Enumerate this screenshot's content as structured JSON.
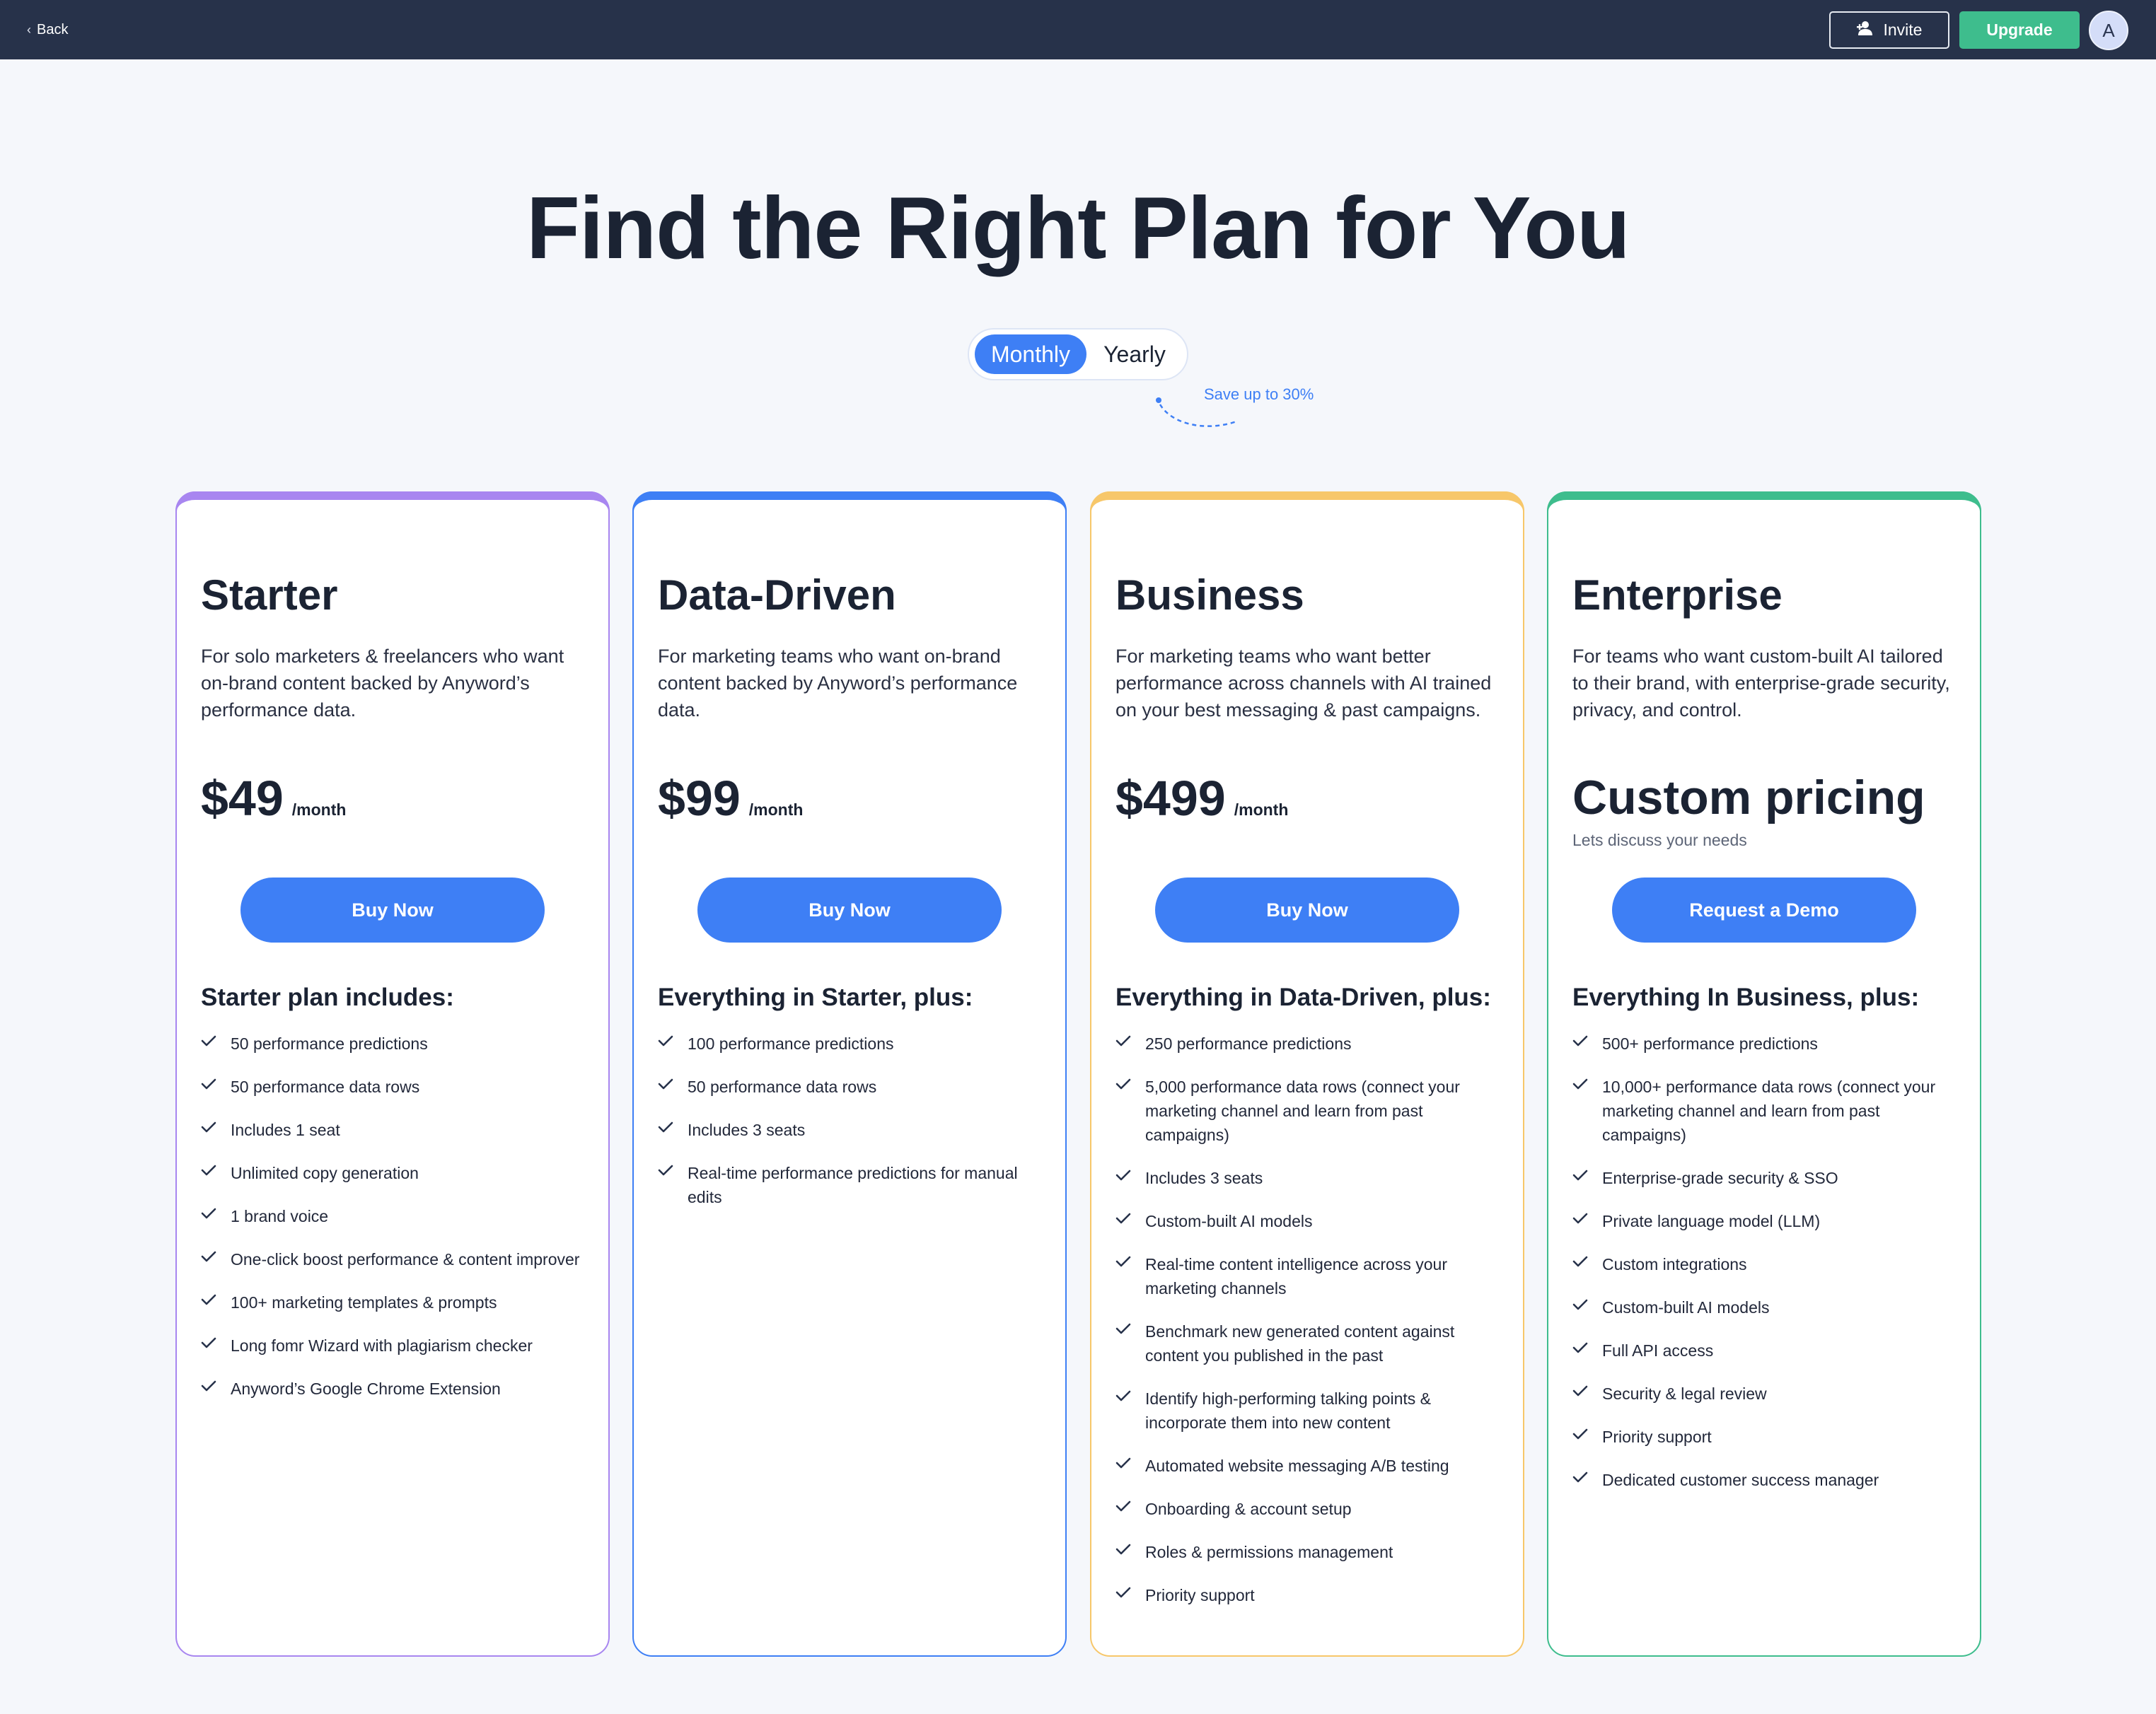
{
  "nav": {
    "back_label": "Back",
    "invite_label": "Invite",
    "upgrade_label": "Upgrade",
    "avatar_initial": "A"
  },
  "hero": {
    "title": "Find the Right Plan for You",
    "toggle": {
      "monthly_label": "Monthly",
      "yearly_label": "Yearly",
      "selected": "Monthly"
    },
    "save_note": "Save up to 30%"
  },
  "plans": [
    {
      "name": "Starter",
      "accent": "#a886f0",
      "description": "For solo marketers & freelancers who want on-brand content backed by Anyword’s performance data.",
      "price": "$49",
      "price_unit": "/month",
      "cta": "Buy Now",
      "features_heading": "Starter plan includes:",
      "features": [
        "50 performance predictions",
        "50 performance data rows",
        "Includes 1 seat",
        "Unlimited copy generation",
        "1 brand voice",
        "One-click boost performance & content improver",
        "100+ marketing templates & prompts",
        "Long fomr Wizard with plagiarism checker",
        "Anyword’s Google Chrome Extension"
      ]
    },
    {
      "name": "Data-Driven",
      "accent": "#3e7ff5",
      "description": "For marketing teams who want on-brand content backed by Anyword’s performance data.",
      "price": "$99",
      "price_unit": "/month",
      "cta": "Buy Now",
      "features_heading": "Everything in Starter, plus:",
      "features": [
        "100 performance predictions",
        "50 performance data rows",
        "Includes 3 seats",
        "Real-time performance predictions for manual edits"
      ]
    },
    {
      "name": "Business",
      "accent": "#f7c76a",
      "description": "For marketing teams who want better performance across channels with AI trained on your best messaging & past campaigns.",
      "price": "$499",
      "price_unit": "/month",
      "cta": "Buy Now",
      "features_heading": "Everything in Data-Driven, plus:",
      "features": [
        "250 performance predictions",
        "5,000 performance data rows (connect your marketing channel and learn from past campaigns)",
        "Includes 3 seats",
        "Custom-built AI models",
        "Real-time content intelligence across your marketing channels",
        "Benchmark new generated content against content you published in the past",
        "Identify high-performing talking points & incorporate them into new content",
        "Automated website messaging A/B testing",
        "Onboarding & account setup",
        "Roles & permissions management",
        "Priority support"
      ]
    },
    {
      "name": "Enterprise",
      "accent": "#3ebd8d",
      "description": "For teams who want custom-built AI tailored to their brand, with enterprise-grade security, privacy, and control.",
      "custom_price": "Custom pricing",
      "custom_price_sub": "Lets discuss your needs",
      "cta": "Request a Demo",
      "features_heading": "Everything In Business, plus:",
      "features": [
        "500+ performance predictions",
        "10,000+ performance data rows (connect your marketing channel and learn from past campaigns)",
        "Enterprise-grade security & SSO",
        "Private language model (LLM)",
        "Custom integrations",
        "Custom-built AI models",
        "Full API access",
        "Security & legal review",
        "Priority support",
        "Dedicated customer success manager"
      ]
    }
  ]
}
